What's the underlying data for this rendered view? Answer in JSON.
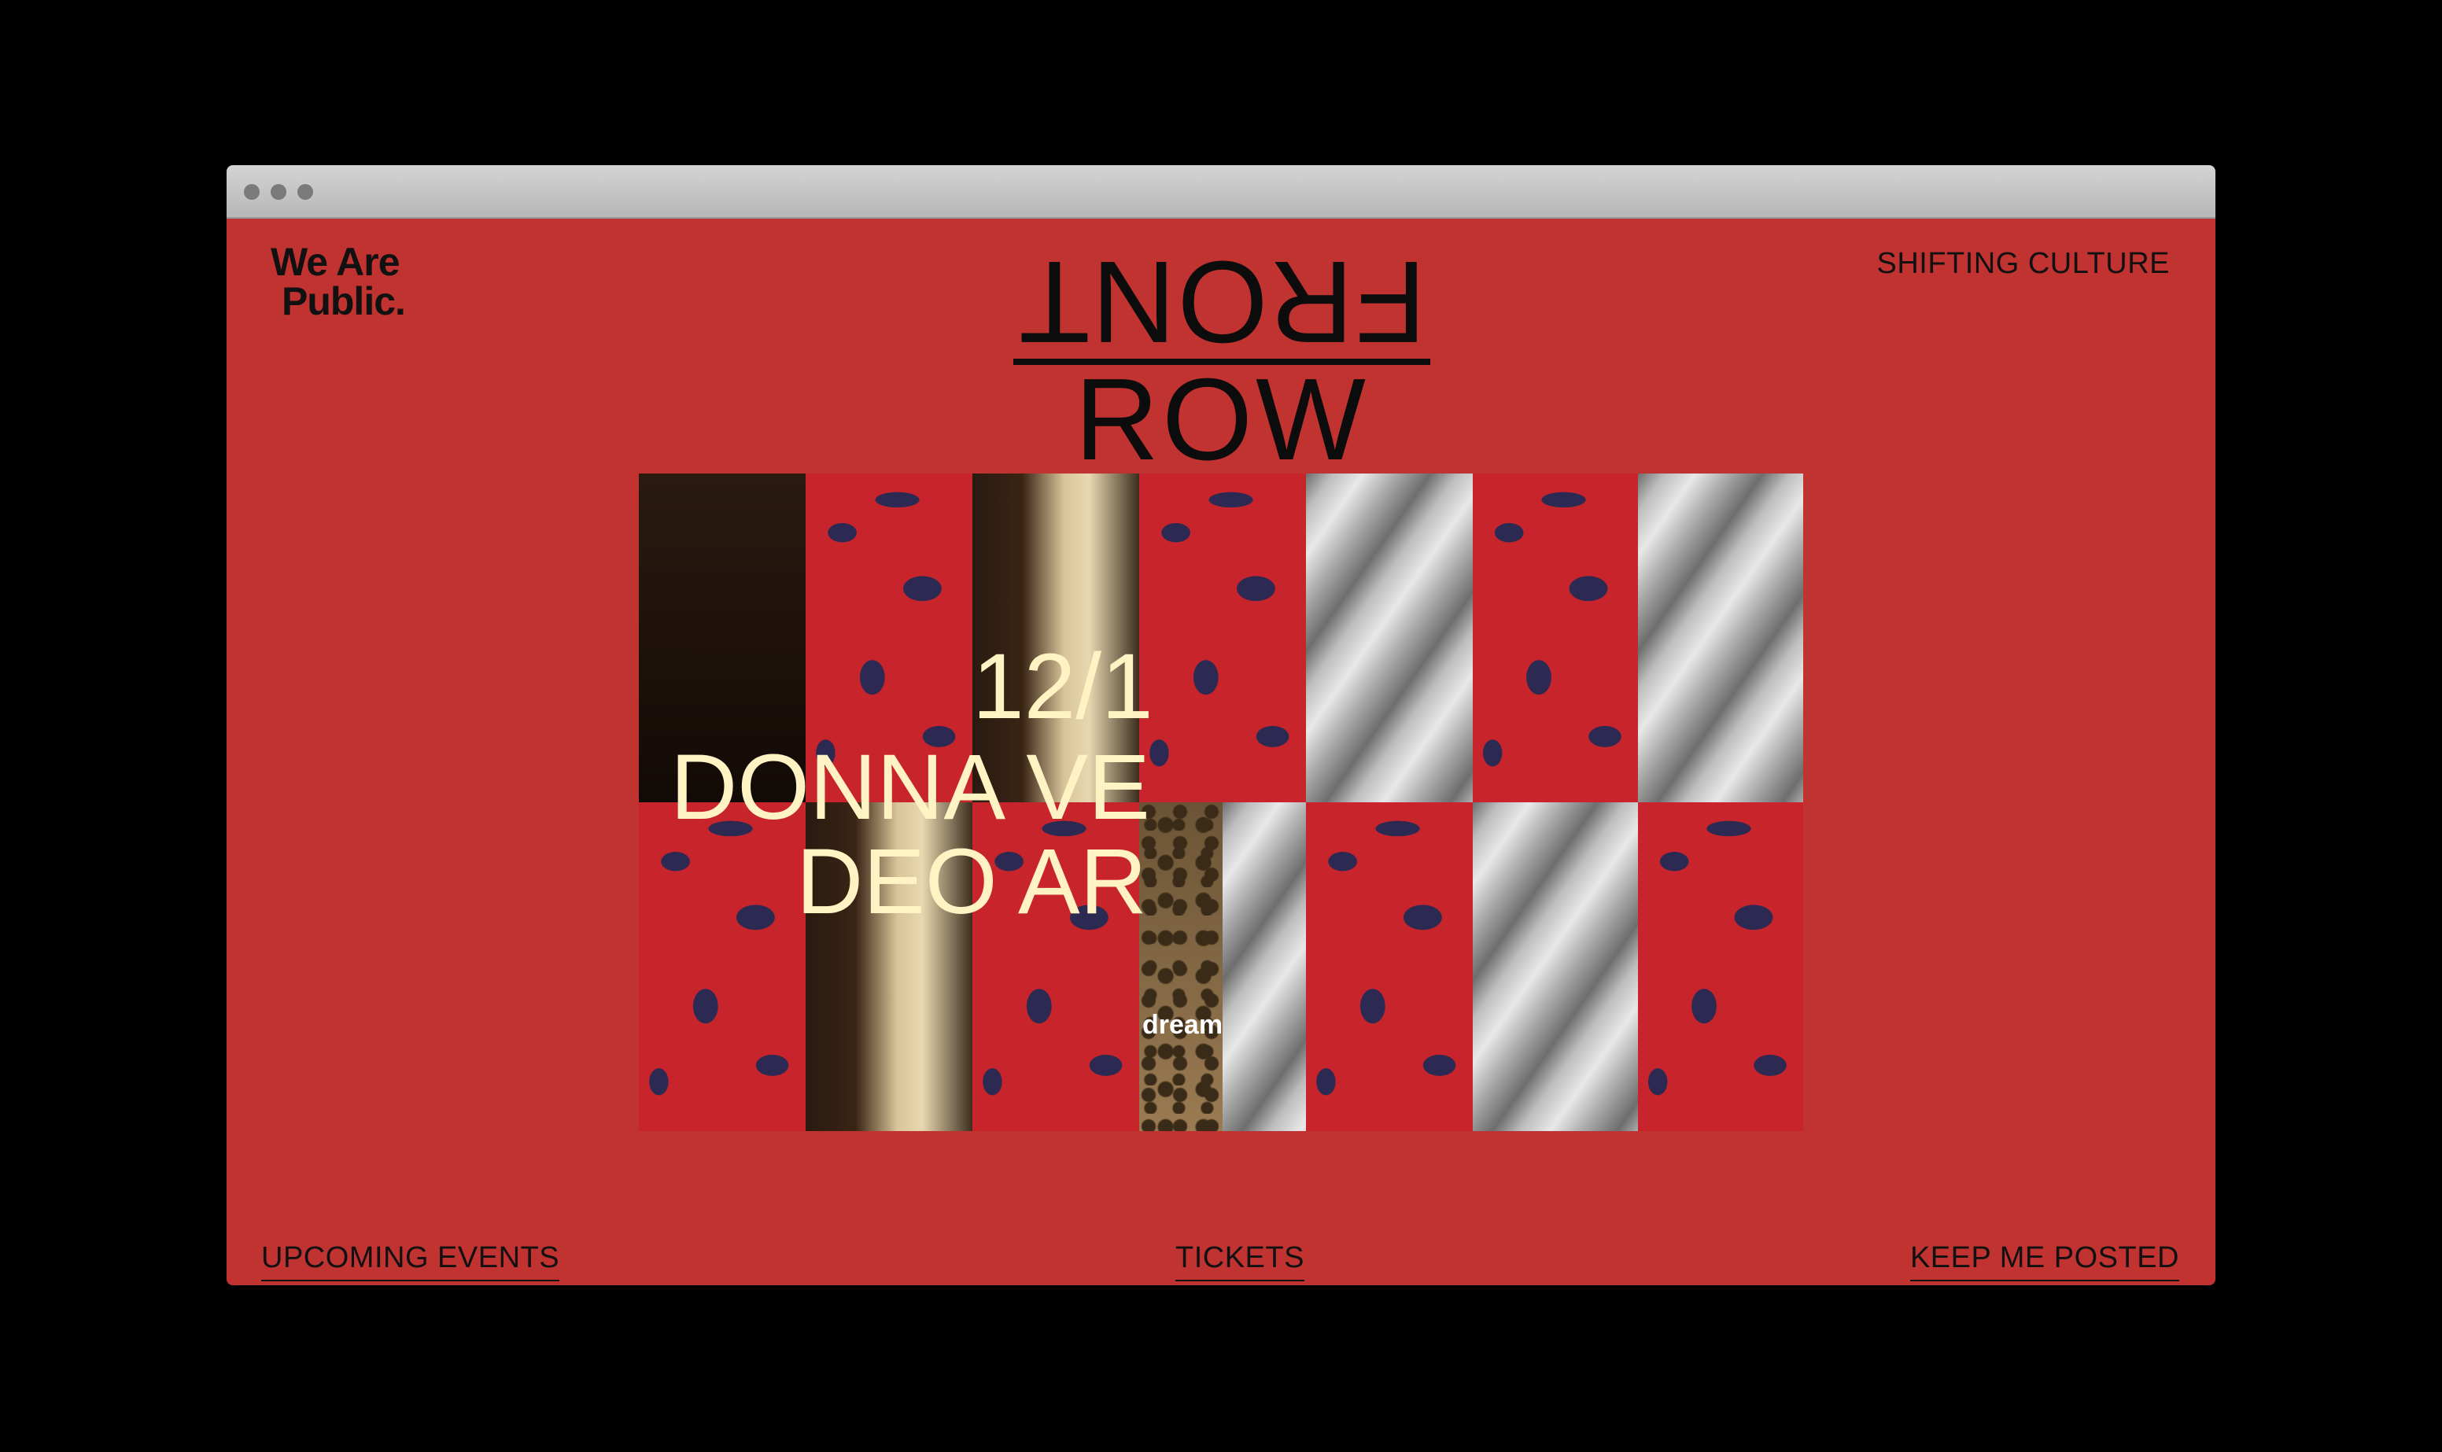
{
  "window": {
    "accent": "#c03331",
    "chrome_dots": 3
  },
  "header": {
    "logo_line1": "We Are",
    "logo_line2": "Public.",
    "tagline": "SHIFTING CULTURE"
  },
  "brand": {
    "top_word": "FRONT",
    "bottom_word": "ROW"
  },
  "mosaic": {
    "date_text": "12/1",
    "headline_fragment_1": "DONNA VE",
    "headline_fragment_2": "DEO AR",
    "caption_fragment": "dream"
  },
  "nav": {
    "upcoming": "UPCOMING EVENTS",
    "tickets": "TICKETS",
    "keep_posted": "KEEP ME POSTED"
  }
}
